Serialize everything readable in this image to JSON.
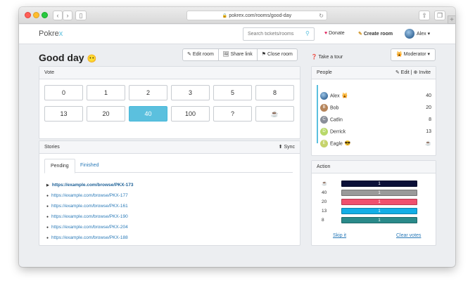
{
  "browser": {
    "url": "pokrex.com/rooms/good-day"
  },
  "appbar": {
    "logo_main": "Pokre",
    "logo_accent": "x",
    "search_placeholder": "Search tickets/rooms",
    "donate": "Donate",
    "create_room": "Create room",
    "user": "Alex"
  },
  "room": {
    "title": "Good day",
    "title_emoji": "😶",
    "buttons": {
      "edit": "Edit room",
      "share": "Share link",
      "close": "Close room"
    },
    "tour": "Take a tour",
    "role": "Moderator"
  },
  "vote": {
    "heading": "Vote",
    "cards": [
      "0",
      "1",
      "2",
      "3",
      "5",
      "8",
      "13",
      "20",
      "40",
      "100",
      "?",
      "☕"
    ],
    "selected": "40"
  },
  "stories": {
    "heading": "Stories",
    "sync": "Sync",
    "tabs": [
      "Pending",
      "Finished"
    ],
    "items": [
      "https://example.com/browse/PKX-173",
      "https://example.com/browse/PKX-177",
      "https://example.com/browse/PKX-161",
      "https://example.com/browse/PKX-190",
      "https://example.com/browse/PKX-204",
      "https://example.com/browse/PKX-188"
    ]
  },
  "people": {
    "heading": "People",
    "edit": "Edit",
    "invite": "Invite",
    "list": [
      {
        "name": "Alex",
        "initial": "",
        "badge": "🙀",
        "vote": "40",
        "color": "#3d6d9c"
      },
      {
        "name": "Bob",
        "initial": "B",
        "badge": "",
        "vote": "20",
        "color": "#b5845a"
      },
      {
        "name": "Catlin",
        "initial": "C",
        "badge": "",
        "vote": "8",
        "color": "#8a8f99"
      },
      {
        "name": "Derrick",
        "initial": "D",
        "badge": "",
        "vote": "13",
        "color": "#b8d96a"
      },
      {
        "name": "Eagle",
        "initial": "E",
        "badge": "😎",
        "vote": "☕",
        "color": "#c6d36b"
      }
    ]
  },
  "action": {
    "heading": "Action",
    "rows": [
      {
        "label": "☕",
        "count": "1",
        "color": "#0b1038"
      },
      {
        "label": "40",
        "count": "1",
        "color": "#9a9a9a"
      },
      {
        "label": "20",
        "count": "1",
        "color": "#f0506e"
      },
      {
        "label": "13",
        "count": "1",
        "color": "#12aee6"
      },
      {
        "label": "8",
        "count": "1",
        "color": "#2a8a8a"
      }
    ],
    "skip": "Skip it",
    "clear": "Clear votes"
  }
}
